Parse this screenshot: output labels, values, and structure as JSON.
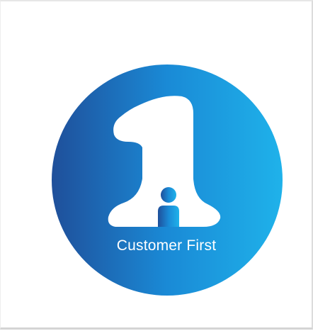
{
  "logo": {
    "text": "Customer First",
    "icon": "number-one-person-icon",
    "colors": {
      "gradient_start": "#1f4f9a",
      "gradient_mid": "#1a8ad6",
      "gradient_end": "#1fb2ea",
      "glyph": "#ffffff"
    }
  }
}
